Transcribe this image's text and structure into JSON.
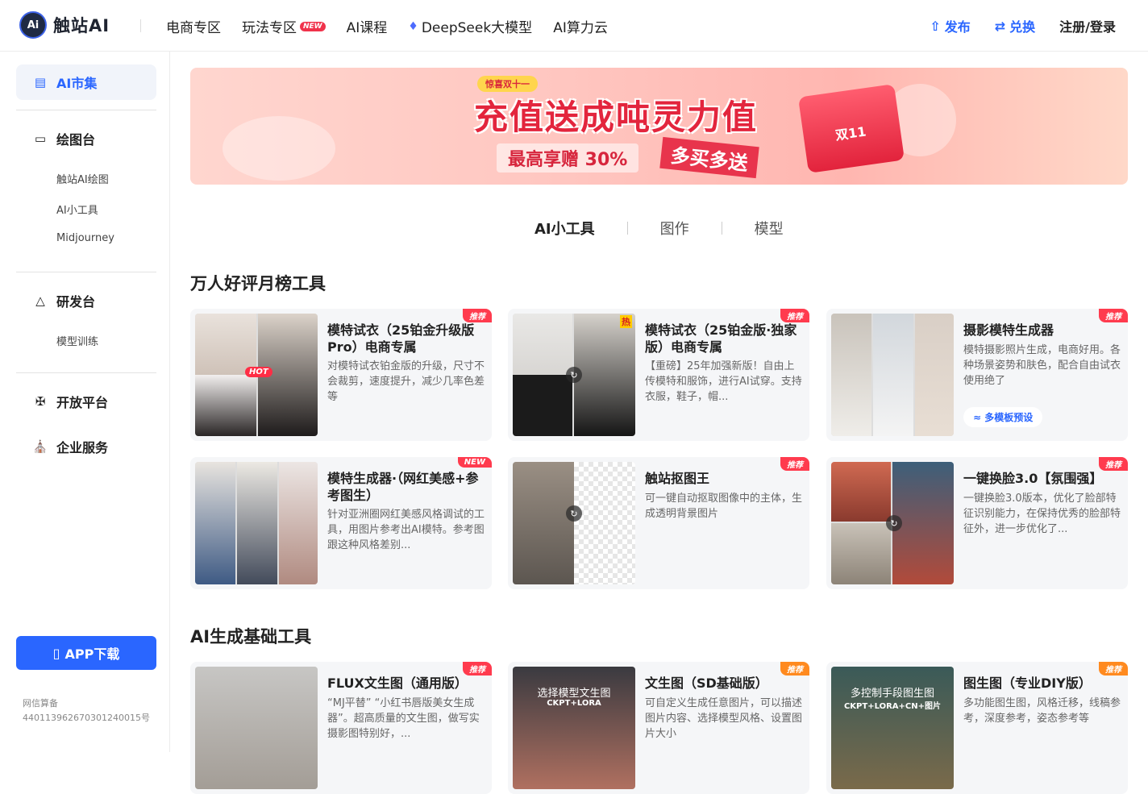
{
  "header": {
    "logo_mark": "Ai",
    "logo_text": "触站AI",
    "nav": [
      {
        "label": "电商专区"
      },
      {
        "label": "玩法专区",
        "badge": "NEW"
      },
      {
        "label": "AI课程"
      },
      {
        "label": "DeepSeek大模型",
        "icon": "whale-icon"
      },
      {
        "label": "AI算力云"
      }
    ],
    "publish": "发布",
    "redeem": "兑换",
    "login": "注册/登录"
  },
  "sidebar": {
    "active": "AI市集",
    "groups": [
      {
        "label": "绘图台",
        "icon": "canvas-icon",
        "subs": [
          "触站AI绘图",
          "AI小工具",
          "Midjourney"
        ]
      },
      {
        "label": "研发台",
        "icon": "flask-icon",
        "subs": [
          "模型训练"
        ]
      },
      {
        "label": "开放平台",
        "icon": "network-icon",
        "subs": []
      },
      {
        "label": "企业服务",
        "icon": "building-icon",
        "subs": []
      }
    ],
    "app_download": "APP下载",
    "icp_line1": "网信算备",
    "icp_line2": "440113962670301240015号"
  },
  "banner": {
    "tag": "惊喜双十一",
    "title": "充值送成吨灵力值",
    "sub": "最高享赠 30%",
    "sub2": "多买多送",
    "box_label": "双11"
  },
  "tabs": [
    "AI小工具",
    "图作",
    "模型"
  ],
  "sections": [
    {
      "title": "万人好评月榜工具",
      "cards": [
        {
          "title": "模特试衣（25铂金升级版Pro）电商专属",
          "desc": "对模特试衣铂金版的升级，尺寸不会裁剪，速度提升，减少几率色差等",
          "badge": "推荐",
          "thumb_tag": "HOT"
        },
        {
          "title": "模特试衣（25铂金版·独家版）电商专属",
          "desc": "【重磅】25年加强新版！自由上传模特和服饰，进行AI试穿。支持衣服，鞋子，帽...",
          "badge": "推荐",
          "thumb_tag": "热"
        },
        {
          "title": "摄影模特生成器",
          "desc": "模特摄影照片生成，电商好用。各种场景姿势和肤色，配合自由试衣使用绝了",
          "badge": "推荐",
          "pill": "多模板预设"
        },
        {
          "title": "模特生成器·（网红美感+参考图生）",
          "desc": "针对亚洲圈网红美感风格调试的工具，用图片参考出AI模特。参考图跟这种风格差别...",
          "badge": "NEW"
        },
        {
          "title": "触站抠图王",
          "desc": "可一键自动抠取图像中的主体，生成透明背景图片",
          "badge": "推荐"
        },
        {
          "title": "一键换脸3.0【氛围强】",
          "desc": "一键换脸3.0版本，优化了脸部特征识别能力，在保持优秀的脸部特征外，进一步优化了...",
          "badge": "推荐"
        }
      ]
    },
    {
      "title": "AI生成基础工具",
      "cards": [
        {
          "title": "FLUX文生图（通用版）",
          "desc": "“MJ平替” “小红书唇版美女生成器”。超高质量的文生图，做写实摄影图特别好，...",
          "badge": "推荐"
        },
        {
          "title": "文生图（SD基础版）",
          "desc": "可自定义生成任意图片，可以描述图片内容、选择模型风格、设置图片大小",
          "badge": "推荐",
          "thumb_l1": "选择模型文生图",
          "thumb_l2": "CKPT+LORA"
        },
        {
          "title": "图生图（专业DIY版）",
          "desc": "多功能图生图，风格迁移，线稿参考，深度参考，姿态参考等",
          "badge": "推荐",
          "thumb_l1": "多控制手段图生图",
          "thumb_l2": "CKPT+LORA+CN+图片"
        }
      ]
    }
  ],
  "colors": {
    "accent": "#2a66ff",
    "badge": "#ff3b4e",
    "new_badge": "#f0324b"
  }
}
